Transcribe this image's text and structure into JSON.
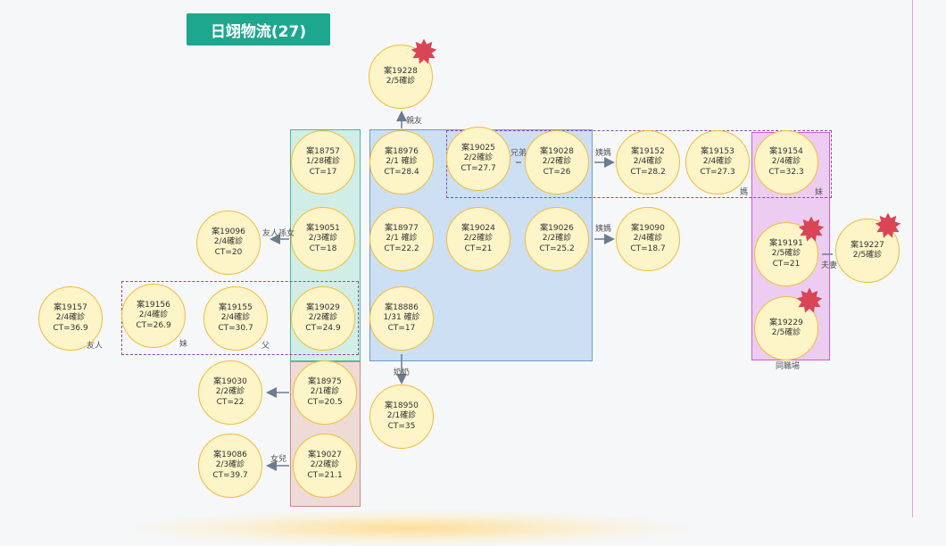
{
  "title": "日翊物流(27)",
  "nodes": [
    {
      "id": "n19228",
      "lines": [
        "案19228",
        "2/5確診"
      ],
      "star": true
    },
    {
      "id": "n18757",
      "lines": [
        "案18757",
        "1/28確診",
        "CT=17"
      ]
    },
    {
      "id": "n18976",
      "lines": [
        "案18976",
        "2/1 確診",
        "CT=28.4"
      ]
    },
    {
      "id": "n19025",
      "lines": [
        "案19025",
        "2/2確診",
        "CT=27.7"
      ]
    },
    {
      "id": "n19028",
      "lines": [
        "案19028",
        "2/2確診",
        "CT=26"
      ]
    },
    {
      "id": "n19152",
      "lines": [
        "案19152",
        "2/4確診",
        "CT=28.2"
      ]
    },
    {
      "id": "n19153",
      "lines": [
        "案19153",
        "2/4確診",
        "CT=27.3"
      ]
    },
    {
      "id": "n19154",
      "lines": [
        "案19154",
        "2/4確診",
        "CT=32.3"
      ]
    },
    {
      "id": "n19096",
      "lines": [
        "案19096",
        "2/4確診",
        "CT=20"
      ]
    },
    {
      "id": "n19051",
      "lines": [
        "案19051",
        "2/3確診",
        "CT=18"
      ]
    },
    {
      "id": "n18977",
      "lines": [
        "案18977",
        "2/1 確診",
        "CT=22.2"
      ]
    },
    {
      "id": "n19024",
      "lines": [
        "案19024",
        "2/2確診",
        "CT=21"
      ]
    },
    {
      "id": "n19026",
      "lines": [
        "案19026",
        "2/2確診",
        "CT=25.2"
      ]
    },
    {
      "id": "n19090",
      "lines": [
        "案19090",
        "2/4確診",
        "CT=18.7"
      ]
    },
    {
      "id": "n19191",
      "lines": [
        "案19191",
        "2/5確診",
        "CT=21"
      ],
      "star": true
    },
    {
      "id": "n19227",
      "lines": [
        "案19227",
        "2/5確診"
      ],
      "star": true
    },
    {
      "id": "n19157",
      "lines": [
        "案19157",
        "2/4確診",
        "CT=36.9"
      ]
    },
    {
      "id": "n19156",
      "lines": [
        "案19156",
        "2/4確診",
        "CT=26.9"
      ]
    },
    {
      "id": "n19155",
      "lines": [
        "案19155",
        "2/4確診",
        "CT=30.7"
      ]
    },
    {
      "id": "n19029",
      "lines": [
        "案19029",
        "2/2確診",
        "CT=24.9"
      ]
    },
    {
      "id": "n18886",
      "lines": [
        "案18886",
        "1/31 確診",
        "CT=17"
      ]
    },
    {
      "id": "n19229",
      "lines": [
        "案19229",
        "2/5確診"
      ],
      "star": true
    },
    {
      "id": "n19030",
      "lines": [
        "案19030",
        "2/2確診",
        "CT=22"
      ]
    },
    {
      "id": "n18975",
      "lines": [
        "案18975",
        "2/1確診",
        "CT=20.5"
      ]
    },
    {
      "id": "n18950",
      "lines": [
        "案18950",
        "2/1確診",
        "CT=35"
      ]
    },
    {
      "id": "n19086",
      "lines": [
        "案19086",
        "2/3確診",
        "CT=39.7"
      ]
    },
    {
      "id": "n19027",
      "lines": [
        "案19027",
        "2/2確診",
        "CT=21.1"
      ]
    }
  ],
  "labels": {
    "qinyou": "親友",
    "xiongdi": "兄弟",
    "yima1": "姨媽",
    "yima2": "姨媽",
    "youren_sunnu": "友人孫女",
    "ma": "媽",
    "mei1": "妹",
    "fuqi": "夫妻",
    "youren": "友人",
    "mei2": "妹",
    "fu": "父",
    "nainai": "奶奶",
    "nuer": "女兒",
    "tongzhichang": "同職場"
  },
  "colors": {
    "title_bg": "#1ea78f",
    "node_fill": "#fdf4c8",
    "node_border": "#efbd3c",
    "star": "#d94457",
    "arrow": "#6b7c8f",
    "dashed": "#8c4aa8"
  }
}
